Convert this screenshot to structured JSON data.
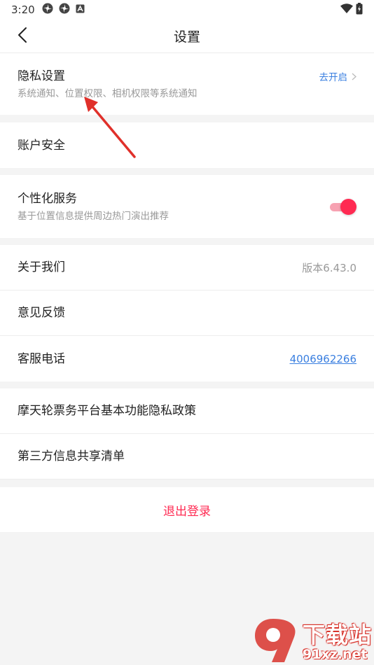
{
  "status_bar": {
    "time": "3:20",
    "left_icons": [
      "pinwheel-icon",
      "pinwheel-icon",
      "app-badge-icon"
    ],
    "right_icons": [
      "wifi-icon",
      "battery-charging-icon"
    ]
  },
  "header": {
    "title": "设置",
    "back_icon": "chevron-left-icon"
  },
  "privacy": {
    "title": "隐私设置",
    "subtitle": "系统通知、位置权限、相机权限等系统通知",
    "action": "去开启"
  },
  "account": {
    "title": "账户安全"
  },
  "personalization": {
    "title": "个性化服务",
    "subtitle": "基于位置信息提供周边热门演出推荐",
    "toggle_on": true
  },
  "about": {
    "title": "关于我们",
    "version": "版本6.43.0"
  },
  "feedback": {
    "title": "意见反馈"
  },
  "support": {
    "title": "客服电话",
    "phone": "4006962266"
  },
  "policy": {
    "title": "摩天轮票务平台基本功能隐私政策"
  },
  "third_party": {
    "title": "第三方信息共享清单"
  },
  "logout": {
    "label": "退出登录"
  },
  "watermark": {
    "title": "下载站",
    "site": "91xz.net"
  },
  "colors": {
    "accent": "#ff2a52",
    "link": "#3a7fe0",
    "annotation": "#e0302a",
    "background": "#f4f4f4"
  }
}
